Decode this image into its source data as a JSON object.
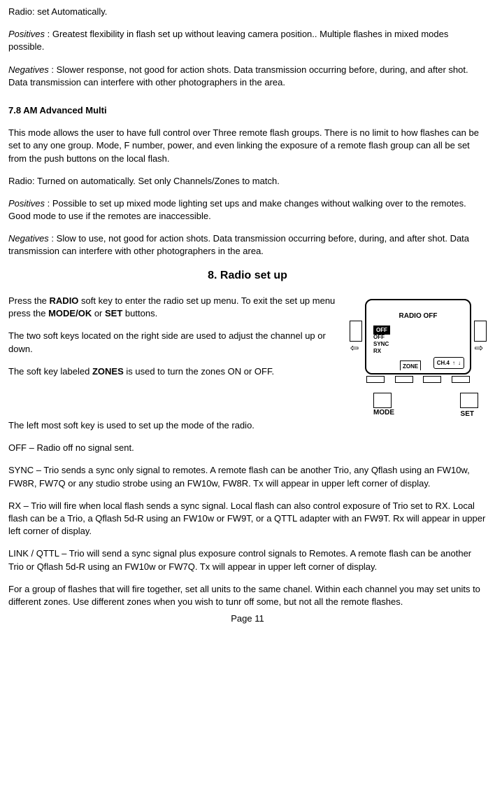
{
  "p1": "Radio: set Automatically.",
  "p2a": "Positives",
  "p2b": " : Greatest flexibility in flash set up without leaving camera position..  Multiple flashes in mixed modes possible.",
  "p3a": "Negatives",
  "p3b": " : Slower response, not good for action shots.  Data transmission occurring before, during, and after shot.  Data transmission can interfere with other photographers in the area.",
  "h78": "7.8   AM  Advanced Multi",
  "p4": "This mode allows the user to have full control over Three remote flash groups.  There is no limit to how flashes can be set to any one group.  Mode, F number, power, and even linking the exposure of a remote flash group can all be set from the push buttons on the local flash.",
  "p5": "Radio: Turned on automatically.  Set only Channels/Zones to match.",
  "p6a": "Positives",
  "p6b": " : Possible to set up mixed mode lighting set ups and make changes without walking over to the remotes.  Good mode to use if the remotes are inaccessible.",
  "p7a": "Negatives",
  "p7b": " : Slow to use, not good for action shots.  Data transmission occurring before, during, and after shot.  Data transmission can interfere with other photographers in the area.",
  "h8": "8.   Radio set up",
  "p8a": "Press the ",
  "p8b": "RADIO",
  "p8c": " soft key to enter the radio set up  menu. To exit the set up menu press the ",
  "p8d": "MODE/OK",
  "p8e": " or ",
  "p8f": "SET",
  "p8g": " buttons.",
  "p9": "The two soft keys located on the right side are used to adjust the channel up or down.",
  "p10a": "The soft key labeled ",
  "p10b": "ZONES",
  "p10c": " is used to turn the zones ON or OFF.",
  "p11": "The left most soft key is used to set up the mode of the radio.",
  "p12": "OFF – Radio off no signal sent.",
  "p13": "SYNC – Trio sends a sync only signal to remotes.  A remote flash can be another Trio, any Qflash using an FW10w, FW8R, FW7Q or any studio strobe using an FW10w, FW8R. Tx will appear in upper left corner of display.",
  "p14": "RX – Trio will fire when local flash sends a sync signal.  Local flash can also control exposure of Trio set to RX.  Local flash can be a Trio, a Qflash 5d-R using an FW10w or FW9T, or a QTTL adapter with an FW9T.  Rx will appear in upper left corner of display.",
  "p15": "LINK / QTTL – Trio will send a sync signal plus exposure control signals to Remotes. A remote flash can be another Trio or Qflash 5d-R using an FW10w or FW7Q.  Tx will appear in upper left corner of display.",
  "p16": "For a group of flashes that will fire together, set all units to the same chanel.  Within each channel you may set units to different zones.  Use different zones when you wish to tunr off some, but not all the remote flashes.",
  "pageNo": "Page 11",
  "lcd": {
    "title": "RADIO OFF",
    "optOff": "OFF",
    "optOff2": "OFF",
    "optSync": "SYNC",
    "optRx": "RX",
    "zone": "ZONE",
    "ch": "CH.4",
    "mode": "MODE",
    "set": "SET"
  }
}
